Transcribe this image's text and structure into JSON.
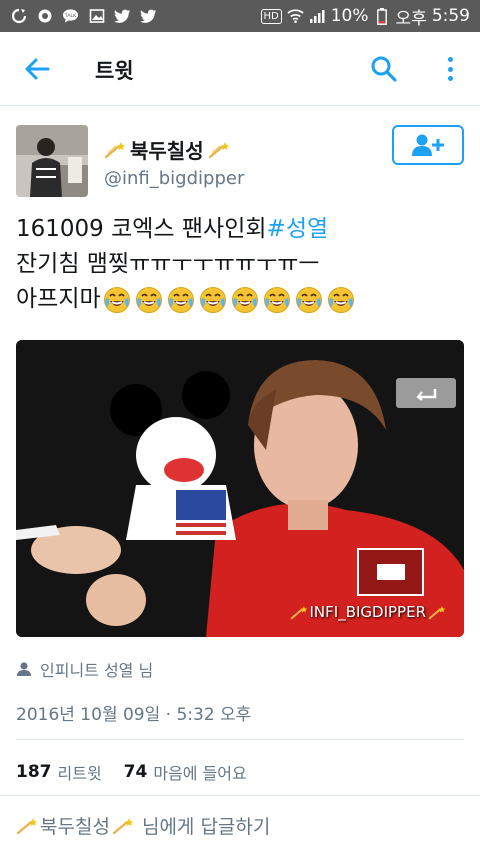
{
  "status_bar": {
    "network_label": "HD",
    "battery": "10%",
    "ampm": "오후",
    "time": "5:59",
    "notification_icons": [
      "sync-icon",
      "circle-icon",
      "talk-icon",
      "image-icon",
      "twitter-icon",
      "twitter-icon"
    ]
  },
  "app_bar": {
    "title": "트윗",
    "accent_color": "#1da1f2"
  },
  "tweet": {
    "display_name": "북두칠성",
    "handle": "@infi_bigdipper",
    "text_line1_plain": "161009 코엑스 팬사인회 ",
    "hashtag": "#성열",
    "text_line2": "잔기침 맴찢ㅠㅠㅜㅜㅠㅠㅜㅠㅡ",
    "text_line3": "아프지마",
    "emoji_count_note": "8 crying-laughing emoji",
    "media_watermark": "INFI_BIGDIPPER",
    "translated_label": "인피니트 성열 님",
    "timestamp": "2016년 10월 09일 · 5:32 오후",
    "retweet_count": "187",
    "retweet_label": "리트윗",
    "like_count": "74",
    "like_label": "마음에 들어요"
  },
  "reply_bar": {
    "name": "북두칠성",
    "suffix": " 님에게 답글하기"
  }
}
